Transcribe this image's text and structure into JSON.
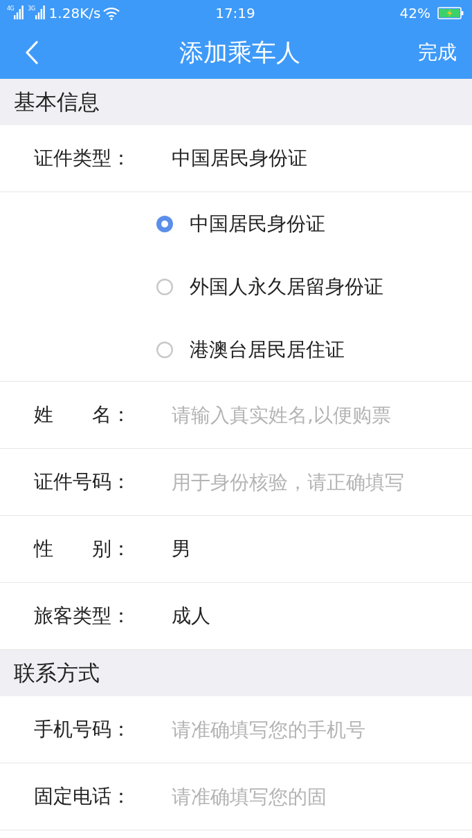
{
  "status_bar": {
    "networks": [
      {
        "label": "4G"
      },
      {
        "label": "3G"
      }
    ],
    "speed": "1.28K/s",
    "time": "17:19",
    "battery": "42%"
  },
  "nav_bar": {
    "title": "添加乘车人",
    "action": "完成"
  },
  "sections": [
    {
      "title": "基本信息",
      "rows": [
        {
          "kind": "value",
          "label": "证件类型：",
          "value": "中国居民身份证"
        },
        {
          "kind": "radio",
          "options": [
            {
              "label": "中国居民身份证",
              "selected": true
            },
            {
              "label": "外国人永久居留身份证",
              "selected": false
            },
            {
              "label": "港澳台居民居住证",
              "selected": false
            }
          ]
        },
        {
          "kind": "input",
          "label": "姓　　名：",
          "placeholder": "请输入真实姓名,以便购票"
        },
        {
          "kind": "input",
          "label": "证件号码：",
          "placeholder": "用于身份核验，请正确填写"
        },
        {
          "kind": "value",
          "label": "性　　别：",
          "value": "男"
        },
        {
          "kind": "value",
          "label": "旅客类型：",
          "value": "成人"
        }
      ]
    },
    {
      "title": "联系方式",
      "rows": [
        {
          "kind": "input",
          "label": "手机号码：",
          "placeholder": "请准确填写您的手机号"
        },
        {
          "kind": "input",
          "label": "固定电话：",
          "placeholder": "请准确填写您的固"
        }
      ]
    }
  ]
}
